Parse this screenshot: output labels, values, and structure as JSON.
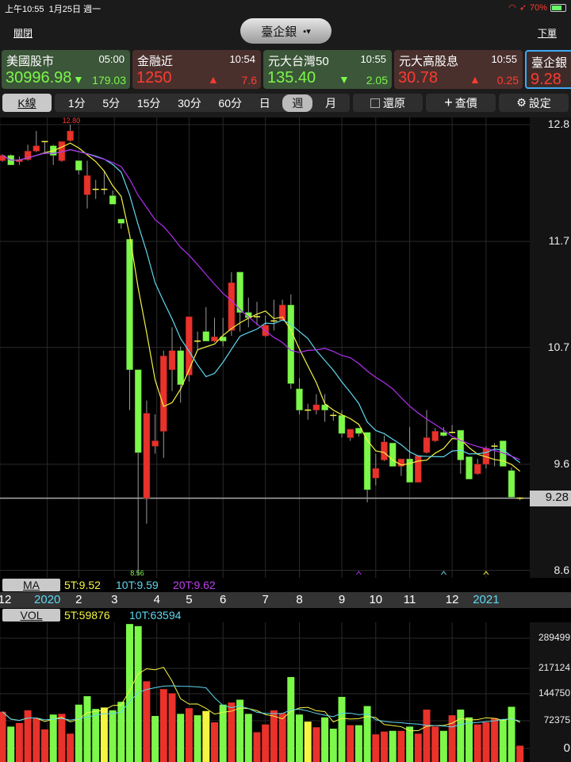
{
  "status": {
    "time": "上午10:55",
    "date": "1月25日 週一",
    "battery": "70%"
  },
  "nav": {
    "close": "關閉",
    "title": "臺企銀",
    "order": "下單"
  },
  "cards": [
    {
      "name": "美國股市",
      "time": "05:00",
      "price": "30996.98",
      "change": "179.03",
      "dir": "down"
    },
    {
      "name": "金融近",
      "time": "10:54",
      "price": "1250",
      "change": "7.6",
      "dir": "up"
    },
    {
      "name": "元大台灣50",
      "time": "10:55",
      "price": "135.40",
      "change": "2.05",
      "dir": "down"
    },
    {
      "name": "元大高股息",
      "time": "10:55",
      "price": "30.78",
      "change": "0.25",
      "dir": "up"
    },
    {
      "name": "臺企銀",
      "time": "",
      "price": "9.28",
      "change": "",
      "dir": "up"
    }
  ],
  "toolbar": {
    "kline": "K線",
    "periods": [
      "1分",
      "5分",
      "15分",
      "30分",
      "60分",
      "日",
      "週",
      "月"
    ],
    "selected_period": "週",
    "restore": "還原",
    "query": "查價",
    "settings": "設定"
  },
  "colors": {
    "up": "#e8322a",
    "down": "#7cf74a",
    "doji": "#f5f542",
    "ma5": "#f5f542",
    "ma10": "#5fd7f0",
    "ma20": "#b030f0"
  },
  "price_axis": {
    "ticks": [
      "12.8",
      "11.7",
      "10.7",
      "9.6",
      "8.6"
    ],
    "current": "9.28",
    "high_label": "12.80",
    "low_label": "8.56"
  },
  "ma_legend": {
    "label": "MA",
    "ma5": "5T:9.52",
    "ma10": "10T:9.59",
    "ma20": "20T:9.62"
  },
  "x_axis": [
    {
      "label": "12",
      "at": -0.3,
      "year": false
    },
    {
      "label": "2020",
      "at": 5.3,
      "year": true
    },
    {
      "label": "2",
      "at": 9,
      "year": false
    },
    {
      "label": "3",
      "at": 13.2,
      "year": false
    },
    {
      "label": "4",
      "at": 18.2,
      "year": false
    },
    {
      "label": "5",
      "at": 22,
      "year": false
    },
    {
      "label": "6",
      "at": 26,
      "year": false
    },
    {
      "label": "7",
      "at": 31,
      "year": false
    },
    {
      "label": "8",
      "at": 35,
      "year": false
    },
    {
      "label": "9",
      "at": 40,
      "year": false
    },
    {
      "label": "10",
      "at": 44,
      "year": false
    },
    {
      "label": "11",
      "at": 48,
      "year": false
    },
    {
      "label": "12",
      "at": 53,
      "year": false
    },
    {
      "label": "2021",
      "at": 57,
      "year": true
    }
  ],
  "vol_legend": {
    "label": "VOL",
    "ma5": "5T:59876",
    "ma10": "10T:63594"
  },
  "vol_axis": [
    "289499",
    "217124",
    "144750",
    "72375",
    "0"
  ],
  "chart_data": {
    "type": "candlestick",
    "fields": [
      "open",
      "high",
      "low",
      "close"
    ],
    "candles": [
      [
        12.46,
        12.52,
        12.45,
        12.51
      ],
      [
        12.51,
        12.52,
        12.42,
        12.42
      ],
      [
        12.45,
        12.5,
        12.42,
        12.47
      ],
      [
        12.47,
        12.61,
        12.46,
        12.55
      ],
      [
        12.55,
        12.74,
        12.54,
        12.6
      ],
      [
        12.64,
        12.64,
        12.52,
        12.64
      ],
      [
        12.6,
        12.61,
        12.42,
        12.51
      ],
      [
        12.46,
        12.64,
        12.45,
        12.64
      ],
      [
        12.65,
        12.8,
        12.64,
        12.74
      ],
      [
        12.46,
        12.46,
        12.33,
        12.37
      ],
      [
        12.14,
        12.46,
        12.01,
        12.32
      ],
      [
        12.19,
        12.28,
        12.1,
        12.19
      ],
      [
        12.19,
        12.37,
        12.14,
        12.19
      ],
      [
        12.13,
        12.18,
        12.05,
        12.05
      ],
      [
        11.91,
        11.91,
        11.82,
        11.87
      ],
      [
        11.72,
        11.72,
        10.11,
        10.49
      ],
      [
        10.49,
        10.49,
        8.56,
        9.71
      ],
      [
        9.28,
        10.2,
        9.04,
        10.08
      ],
      [
        9.77,
        10.07,
        9.7,
        9.82
      ],
      [
        9.91,
        10.67,
        9.66,
        10.62
      ],
      [
        10.49,
        10.89,
        10.29,
        10.67
      ],
      [
        10.67,
        10.71,
        10.18,
        10.35
      ],
      [
        10.44,
        10.99,
        10.38,
        10.99
      ],
      [
        10.76,
        10.85,
        10.68,
        10.76
      ],
      [
        10.85,
        11.08,
        10.76,
        10.76
      ],
      [
        10.76,
        10.98,
        10.75,
        10.8
      ],
      [
        10.8,
        10.98,
        10.71,
        10.76
      ],
      [
        10.86,
        11.41,
        10.81,
        11.31
      ],
      [
        11.41,
        11.41,
        10.85,
        11.03
      ],
      [
        11.03,
        11.17,
        10.89,
        10.98
      ],
      [
        10.99,
        11.13,
        10.91,
        10.99
      ],
      [
        10.81,
        11.0,
        10.8,
        10.91
      ],
      [
        10.95,
        11.15,
        10.86,
        10.95
      ],
      [
        10.96,
        11.15,
        10.95,
        11.1
      ],
      [
        11.1,
        11.2,
        10.31,
        10.36
      ],
      [
        10.31,
        10.41,
        10.07,
        10.11
      ],
      [
        10.11,
        10.17,
        10.02,
        10.11
      ],
      [
        10.11,
        10.26,
        10.07,
        10.16
      ],
      [
        10.16,
        10.26,
        10.0,
        10.11
      ],
      [
        10.06,
        10.09,
        10.01,
        10.06
      ],
      [
        10.06,
        10.11,
        9.85,
        9.89
      ],
      [
        9.85,
        9.93,
        9.82,
        9.93
      ],
      [
        9.94,
        9.94,
        9.86,
        9.89
      ],
      [
        9.9,
        9.9,
        9.24,
        9.36
      ],
      [
        9.47,
        9.7,
        9.4,
        9.56
      ],
      [
        9.64,
        9.87,
        9.63,
        9.81
      ],
      [
        9.8,
        9.8,
        9.58,
        9.58
      ],
      [
        9.58,
        9.65,
        9.49,
        9.65
      ],
      [
        9.65,
        9.95,
        9.43,
        9.43
      ],
      [
        9.43,
        9.68,
        9.43,
        9.68
      ],
      [
        9.71,
        10.11,
        9.7,
        9.85
      ],
      [
        9.82,
        9.94,
        9.81,
        9.91
      ],
      [
        9.9,
        9.95,
        9.86,
        9.87
      ],
      [
        9.9,
        9.97,
        9.89,
        9.9
      ],
      [
        9.92,
        9.92,
        9.51,
        9.64
      ],
      [
        9.67,
        9.67,
        9.46,
        9.46
      ],
      [
        9.51,
        9.65,
        9.5,
        9.6
      ],
      [
        9.6,
        9.77,
        9.56,
        9.75
      ],
      [
        9.77,
        9.8,
        9.58,
        9.77
      ],
      [
        9.82,
        9.82,
        9.58,
        9.58
      ],
      [
        9.54,
        9.57,
        9.28,
        9.29
      ],
      [
        9.28,
        9.29,
        9.26,
        9.28
      ]
    ],
    "volumes": [
      96500,
      57500,
      66800,
      100200,
      79800,
      50100,
      89100,
      90900,
      39000,
      115100,
      137300,
      103900,
      107600,
      100200,
      122500,
      326700,
      321100,
      176300,
      85400,
      155900,
      144800,
      90900,
      105800,
      87200,
      98400,
      68700,
      115100,
      120600,
      128100,
      90900,
      42700,
      63100,
      100200,
      92800,
      187500,
      89100,
      70500,
      55700,
      81700,
      52000,
      135500,
      61200,
      61200,
      111400,
      37100,
      44500,
      46400,
      46400,
      57500,
      39000,
      102100,
      57500,
      46400,
      87200,
      102100,
      81700,
      63100,
      68700,
      79800,
      76100,
      109500,
      7400
    ],
    "volume_colors": [
      "u",
      "d",
      "u",
      "u",
      "u",
      "u",
      "d",
      "u",
      "u",
      "d",
      "d",
      "d",
      "n",
      "d",
      "d",
      "d",
      "d",
      "u",
      "d",
      "u",
      "u",
      "d",
      "u",
      "d",
      "n",
      "u",
      "d",
      "u",
      "d",
      "d",
      "u",
      "u",
      "u",
      "u",
      "d",
      "d",
      "n",
      "u",
      "d",
      "d",
      "d",
      "u",
      "d",
      "d",
      "u",
      "u",
      "d",
      "u",
      "d",
      "u",
      "u",
      "u",
      "d",
      "u",
      "d",
      "d",
      "u",
      "u",
      "u",
      "d",
      "d",
      "u"
    ],
    "price_range": [
      8.56,
      12.8
    ],
    "volume_max": 289499
  }
}
